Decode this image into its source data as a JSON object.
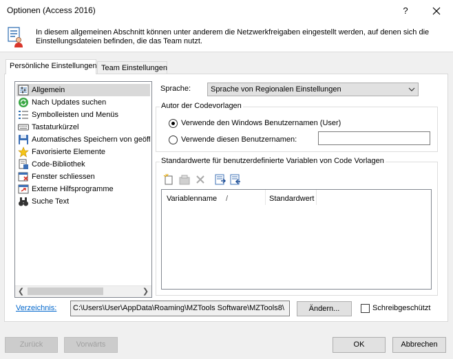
{
  "window": {
    "title": "Optionen (Access 2016)",
    "help_glyph": "?"
  },
  "header": {
    "text": "In diesem allgemeinen Abschnitt können unter anderem die Netzwerkfreigaben eingestellt werden, auf denen sich die Einstellungsdateien befinden, die das Team nutzt."
  },
  "tabs": [
    {
      "label": "Persönliche Einstellungen",
      "active": true
    },
    {
      "label": "Team Einstellungen",
      "active": false
    }
  ],
  "categories": [
    {
      "label": "Allgemein",
      "icon": "settings-icon",
      "selected": true
    },
    {
      "label": "Nach Updates suchen",
      "icon": "update-icon",
      "selected": false
    },
    {
      "label": "Symbolleisten und Menüs",
      "icon": "toolbar-menu-icon",
      "selected": false
    },
    {
      "label": "Tastaturkürzel",
      "icon": "keyboard-icon",
      "selected": false
    },
    {
      "label": "Automatisches Speichern von geöffr",
      "icon": "autosave-icon",
      "selected": false
    },
    {
      "label": "Favorisierte Elemente",
      "icon": "star-icon",
      "selected": false
    },
    {
      "label": "Code-Bibliothek",
      "icon": "code-library-icon",
      "selected": false
    },
    {
      "label": "Fenster schliessen",
      "icon": "close-window-icon",
      "selected": false
    },
    {
      "label": "Externe Hilfsprogramme",
      "icon": "external-tools-icon",
      "selected": false
    },
    {
      "label": "Suche Text",
      "icon": "binoculars-icon",
      "selected": false
    }
  ],
  "language": {
    "label": "Sprache:",
    "value": "Sprache von Regionalen Einstellungen"
  },
  "author_group": {
    "title": "Autor der Codevorlagen",
    "option_windows": "Verwende den Windows Benutzernamen (User)",
    "option_custom": "Verwende diesen Benutzernamen:",
    "selected": "windows",
    "custom_name_value": ""
  },
  "variables_group": {
    "title": "Standardwerte für benutzerdefinierte Variablen von Code Vorlagen",
    "toolbar": [
      "new-item-icon",
      "edit-item-icon",
      "delete-icon",
      "import-icon",
      "export-icon"
    ],
    "columns": [
      "Variablenname",
      "Standardwert"
    ],
    "sort_glyph": "/",
    "rows": []
  },
  "directory": {
    "link_label": "Verzeichnis:",
    "path": "C:\\Users\\User\\AppData\\Roaming\\MZTools Software\\MZTools8\\",
    "change_button": "Ändern...",
    "readonly_label": "Schreibgeschützt",
    "readonly_checked": false
  },
  "footer": {
    "back": "Zurück",
    "forward": "Vorwärts",
    "ok": "OK",
    "cancel": "Abbrechen"
  },
  "colors": {
    "accent": "#0078d7",
    "link": "#0066cc",
    "selection": "#d9d9d9"
  }
}
